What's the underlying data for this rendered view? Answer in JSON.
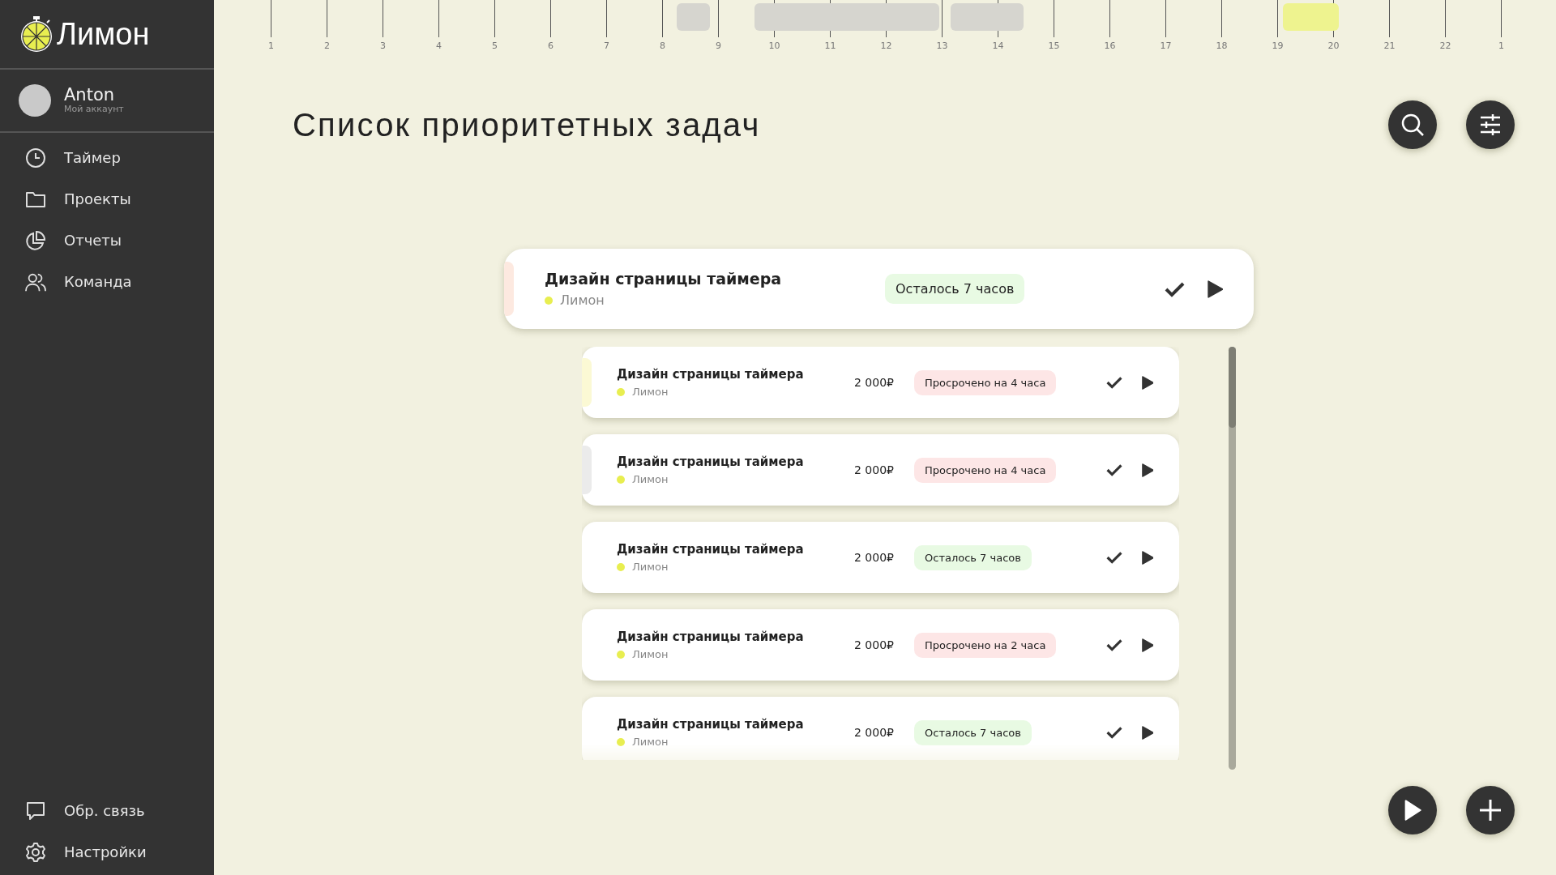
{
  "sidebar": {
    "logo": "Лимон",
    "user": {
      "name": "Anton",
      "subtitle": "Мой аккаунт"
    },
    "nav": [
      {
        "label": "Таймер"
      },
      {
        "label": "Проекты"
      },
      {
        "label": "Отчеты"
      },
      {
        "label": "Команда"
      }
    ],
    "bottom_nav": [
      {
        "label": "Обр. связь"
      },
      {
        "label": "Настройки"
      }
    ]
  },
  "timeline": {
    "hours": [
      "1",
      "2",
      "3",
      "4",
      "5",
      "6",
      "7",
      "8",
      "9",
      "10",
      "11",
      "12",
      "13",
      "14",
      "15",
      "16",
      "17",
      "18",
      "19",
      "20",
      "21",
      "22",
      "1"
    ],
    "blocks": [
      {
        "color": "#d6d5cf"
      },
      {
        "color": "#d6d5cf"
      },
      {
        "color": "#d6d5cf"
      },
      {
        "color": "#eef38f"
      }
    ]
  },
  "header": {
    "title": "Список приоритетных задач"
  },
  "current_task": {
    "title": "Дизайн страницы таймера",
    "project": {
      "name": "Лимон",
      "color": "#e8ee50"
    },
    "accent": {
      "color": "#fde9e0"
    },
    "status": {
      "text": "Осталось 7 часов",
      "kind": "remaining"
    }
  },
  "tasks": [
    {
      "title": "Дизайн страницы таймера",
      "project": {
        "name": "Лимон",
        "color": "#e8ee50"
      },
      "accent": {
        "color": "#fbf9d4"
      },
      "price": "2 000₽",
      "status": {
        "text": "Просрочено на 4 часа",
        "kind": "overdue"
      }
    },
    {
      "title": "Дизайн страницы таймера",
      "project": {
        "name": "Лимон",
        "color": "#e8ee50"
      },
      "accent": {
        "color": "#ebebeb"
      },
      "price": "2 000₽",
      "status": {
        "text": "Просрочено на 4 часа",
        "kind": "overdue"
      }
    },
    {
      "title": "Дизайн страницы таймера",
      "project": {
        "name": "Лимон",
        "color": "#e8ee50"
      },
      "price": "2 000₽",
      "status": {
        "text": "Осталось 7 часов",
        "kind": "remaining"
      }
    },
    {
      "title": "Дизайн страницы таймера",
      "project": {
        "name": "Лимон",
        "color": "#e8ee50"
      },
      "price": "2 000₽",
      "status": {
        "text": "Просрочено на 2 часа",
        "kind": "overdue"
      }
    },
    {
      "title": "Дизайн страницы таймера",
      "project": {
        "name": "Лимон",
        "color": "#e8ee50"
      },
      "price": "2 000₽",
      "status": {
        "text": "Осталось 7 часов",
        "kind": "remaining"
      }
    }
  ]
}
